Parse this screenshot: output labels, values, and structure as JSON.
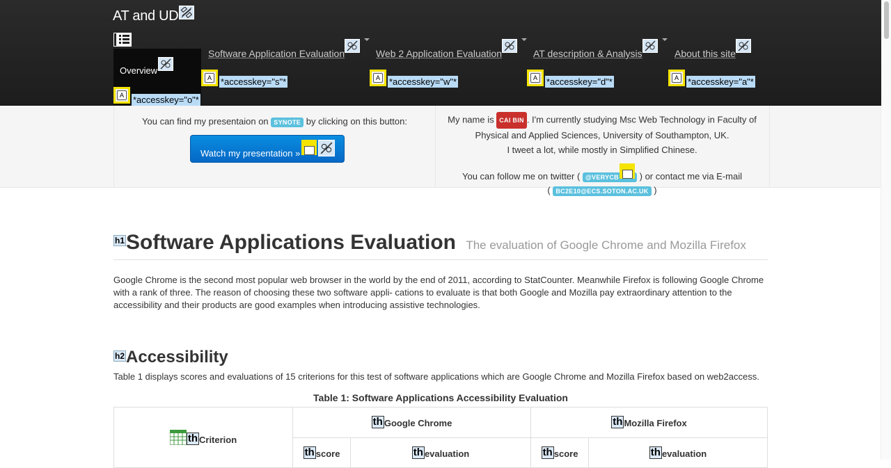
{
  "nav": {
    "brand": "AT and UD",
    "items": [
      {
        "label": "Overview",
        "accesskey": "*accesskey=\"o\"*"
      },
      {
        "label": "Software Application Evaluation",
        "accesskey": "*accesskey=\"s\"*"
      },
      {
        "label": "Web 2 Application Evaluation",
        "accesskey": "*accesskey=\"w\"*"
      },
      {
        "label": "AT description & Analysis",
        "accesskey": "*accesskey=\"d\"*"
      },
      {
        "label": "About this site",
        "accesskey": "*accesskey=\"a\"*"
      }
    ]
  },
  "hero": {
    "left": {
      "text_before": "You can find my presentaion on",
      "badge": "SYNOTE",
      "text_after": "by clicking on this button:",
      "button": "Watch my presentation »"
    },
    "right": {
      "name_before": "My name is",
      "name_badge": "CAI BIN",
      "name_after": ". I'm currently studying Msc Web Technology in Faculty of Physical and Applied Sciences, University of Southampton, UK.",
      "tweet": "I tweet a lot, while mostly in Simplified Chinese.",
      "follow_before": "You can follow me on twitter (",
      "twitter_badge": "@VERYCB",
      "follow_after": ") or contact me via E-mail",
      "email_open": "(",
      "email_badge": "BC2E10@ECS.SOTON.AC.UK",
      "email_close": ")"
    }
  },
  "main": {
    "h1_tag": "h1",
    "h1": "Software Applications Evaluation",
    "h1_small": "The evaluation of Google Chrome and Mozilla Firefox",
    "intro": "Google Chrome is the second most popular web browser in the world by the end of 2011, according to StatCounter. Meanwhile Firefox is following Google Chrome with a rank of three. The reason of choosing these two software appli- cations to evaluate is that both Google and Mozilla pay extraordinary attention to the accessibility and their products are good examples when introducing assistive technologies.",
    "h2_tag": "h2",
    "h2": "Accessibility",
    "table_desc": "Table 1 displays scores and evaluations of 15 criterions for this test of software applications which are Google Chrome and Mozilla Firefox based on web2access.",
    "caption": "Table 1: Software Applications Accessibility Evaluation",
    "table": {
      "th_tag": "th",
      "criterion": "Criterion",
      "chrome": "Google Chrome",
      "firefox": "Mozilla Firefox",
      "score": "score",
      "evaluation": "evaluation"
    }
  }
}
